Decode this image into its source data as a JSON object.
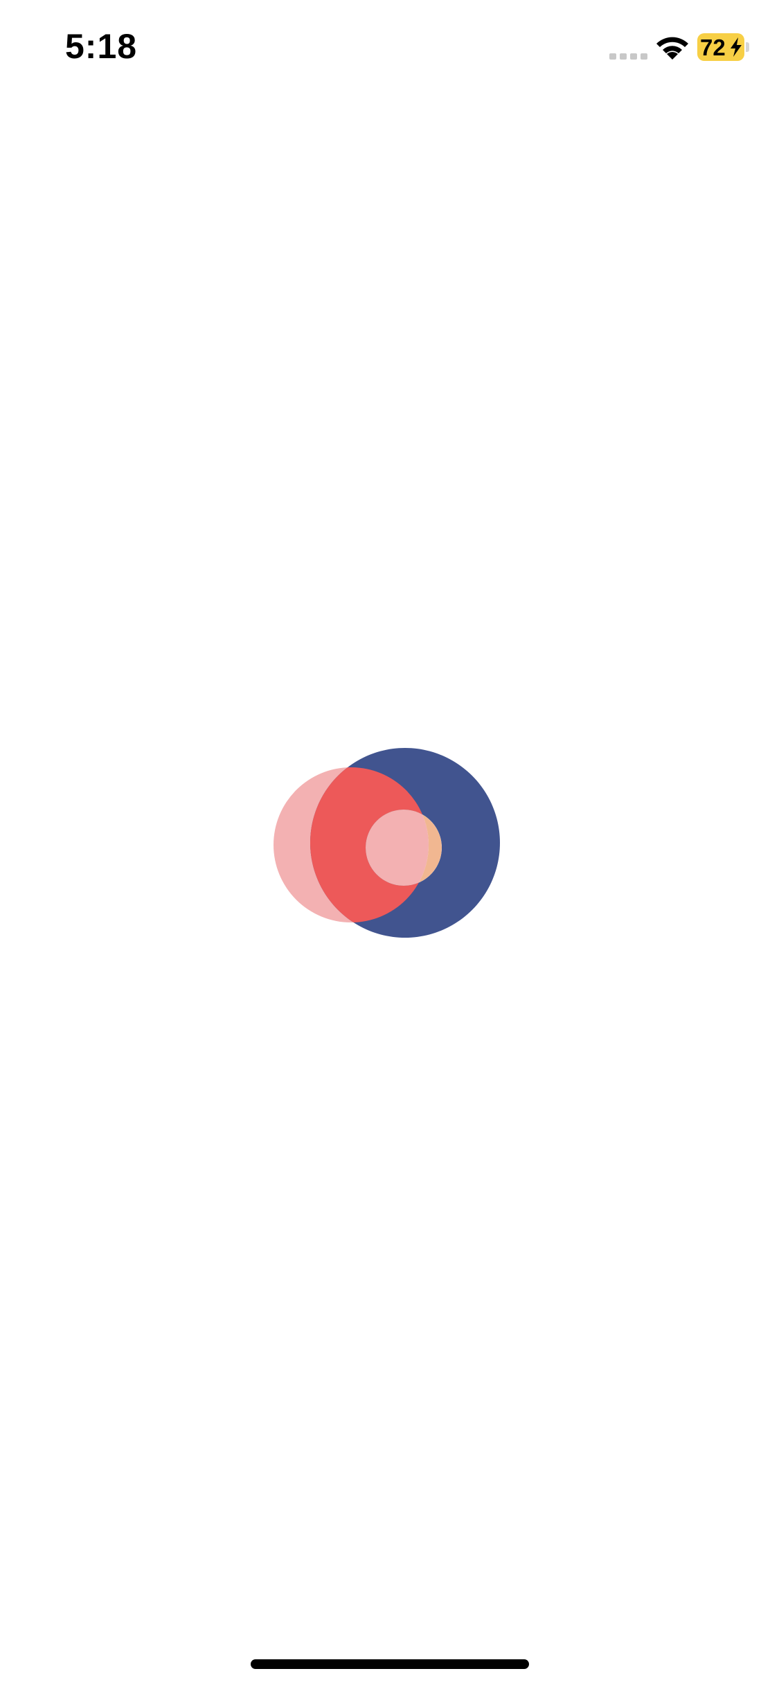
{
  "status_bar": {
    "time": "5:18",
    "battery_level": "72",
    "charging": true,
    "signal_icon": "cellular-signal-icon",
    "wifi_icon": "wifi-icon",
    "battery_icon": "battery-charging-icon"
  },
  "splash": {
    "logo_icon": "app-logo-overlapping-circles",
    "colors": {
      "blue_ring": "#41548f",
      "pink_circle": "#f3b1b2",
      "red_overlap": "#ed5959",
      "peach_crescent": "#f1b791",
      "background": "#ffffff"
    }
  },
  "theme": {
    "battery_color": "#f7cf45",
    "home_indicator": "#000000"
  }
}
